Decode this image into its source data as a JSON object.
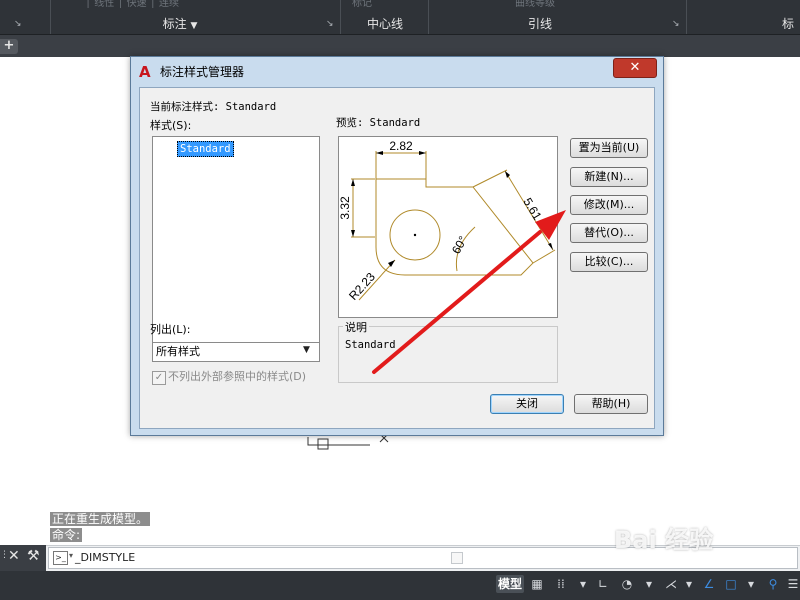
{
  "ribbon": {
    "panels": [
      {
        "title": "标注",
        "arrow": "▼"
      },
      {
        "title": "中心线"
      },
      {
        "title": "引线"
      },
      {
        "title": "标"
      }
    ],
    "ghost_labels": [
      "标记",
      "曲线等级"
    ],
    "tab_add": "+"
  },
  "dialog": {
    "title": "标注样式管理器",
    "close": "✕",
    "current_style_label": "当前标注样式: Standard",
    "styles_label": "样式(S):",
    "styles": [
      "Standard"
    ],
    "preview_label": "预览: Standard",
    "preview_dims": {
      "top": "2.82",
      "left": "3.32",
      "right": "5.61",
      "angle": "60°",
      "radius": "R2.23"
    },
    "list_label": "列出(L):",
    "list_value": "所有样式",
    "checkbox_label": "不列出外部参照中的样式(D)",
    "checkbox_checked": true,
    "description_label": "说明",
    "description_text": "Standard",
    "buttons": {
      "set_current": "置为当前(U)",
      "new": "新建(N)...",
      "modify": "修改(M)...",
      "override": "替代(O)...",
      "compare": "比较(C)..."
    },
    "close_button": "关闭",
    "help_button": "帮助(H)"
  },
  "command": {
    "history": [
      "正在重生成模型。",
      "命令:"
    ],
    "input_value": "_DIMSTYLE"
  },
  "statusbar": {
    "model": "模型"
  },
  "watermark": "Bai 经验",
  "colors": {
    "arrow": "#e21b1b",
    "dim_color": "#b08a2a",
    "selection": "#3399ff"
  }
}
